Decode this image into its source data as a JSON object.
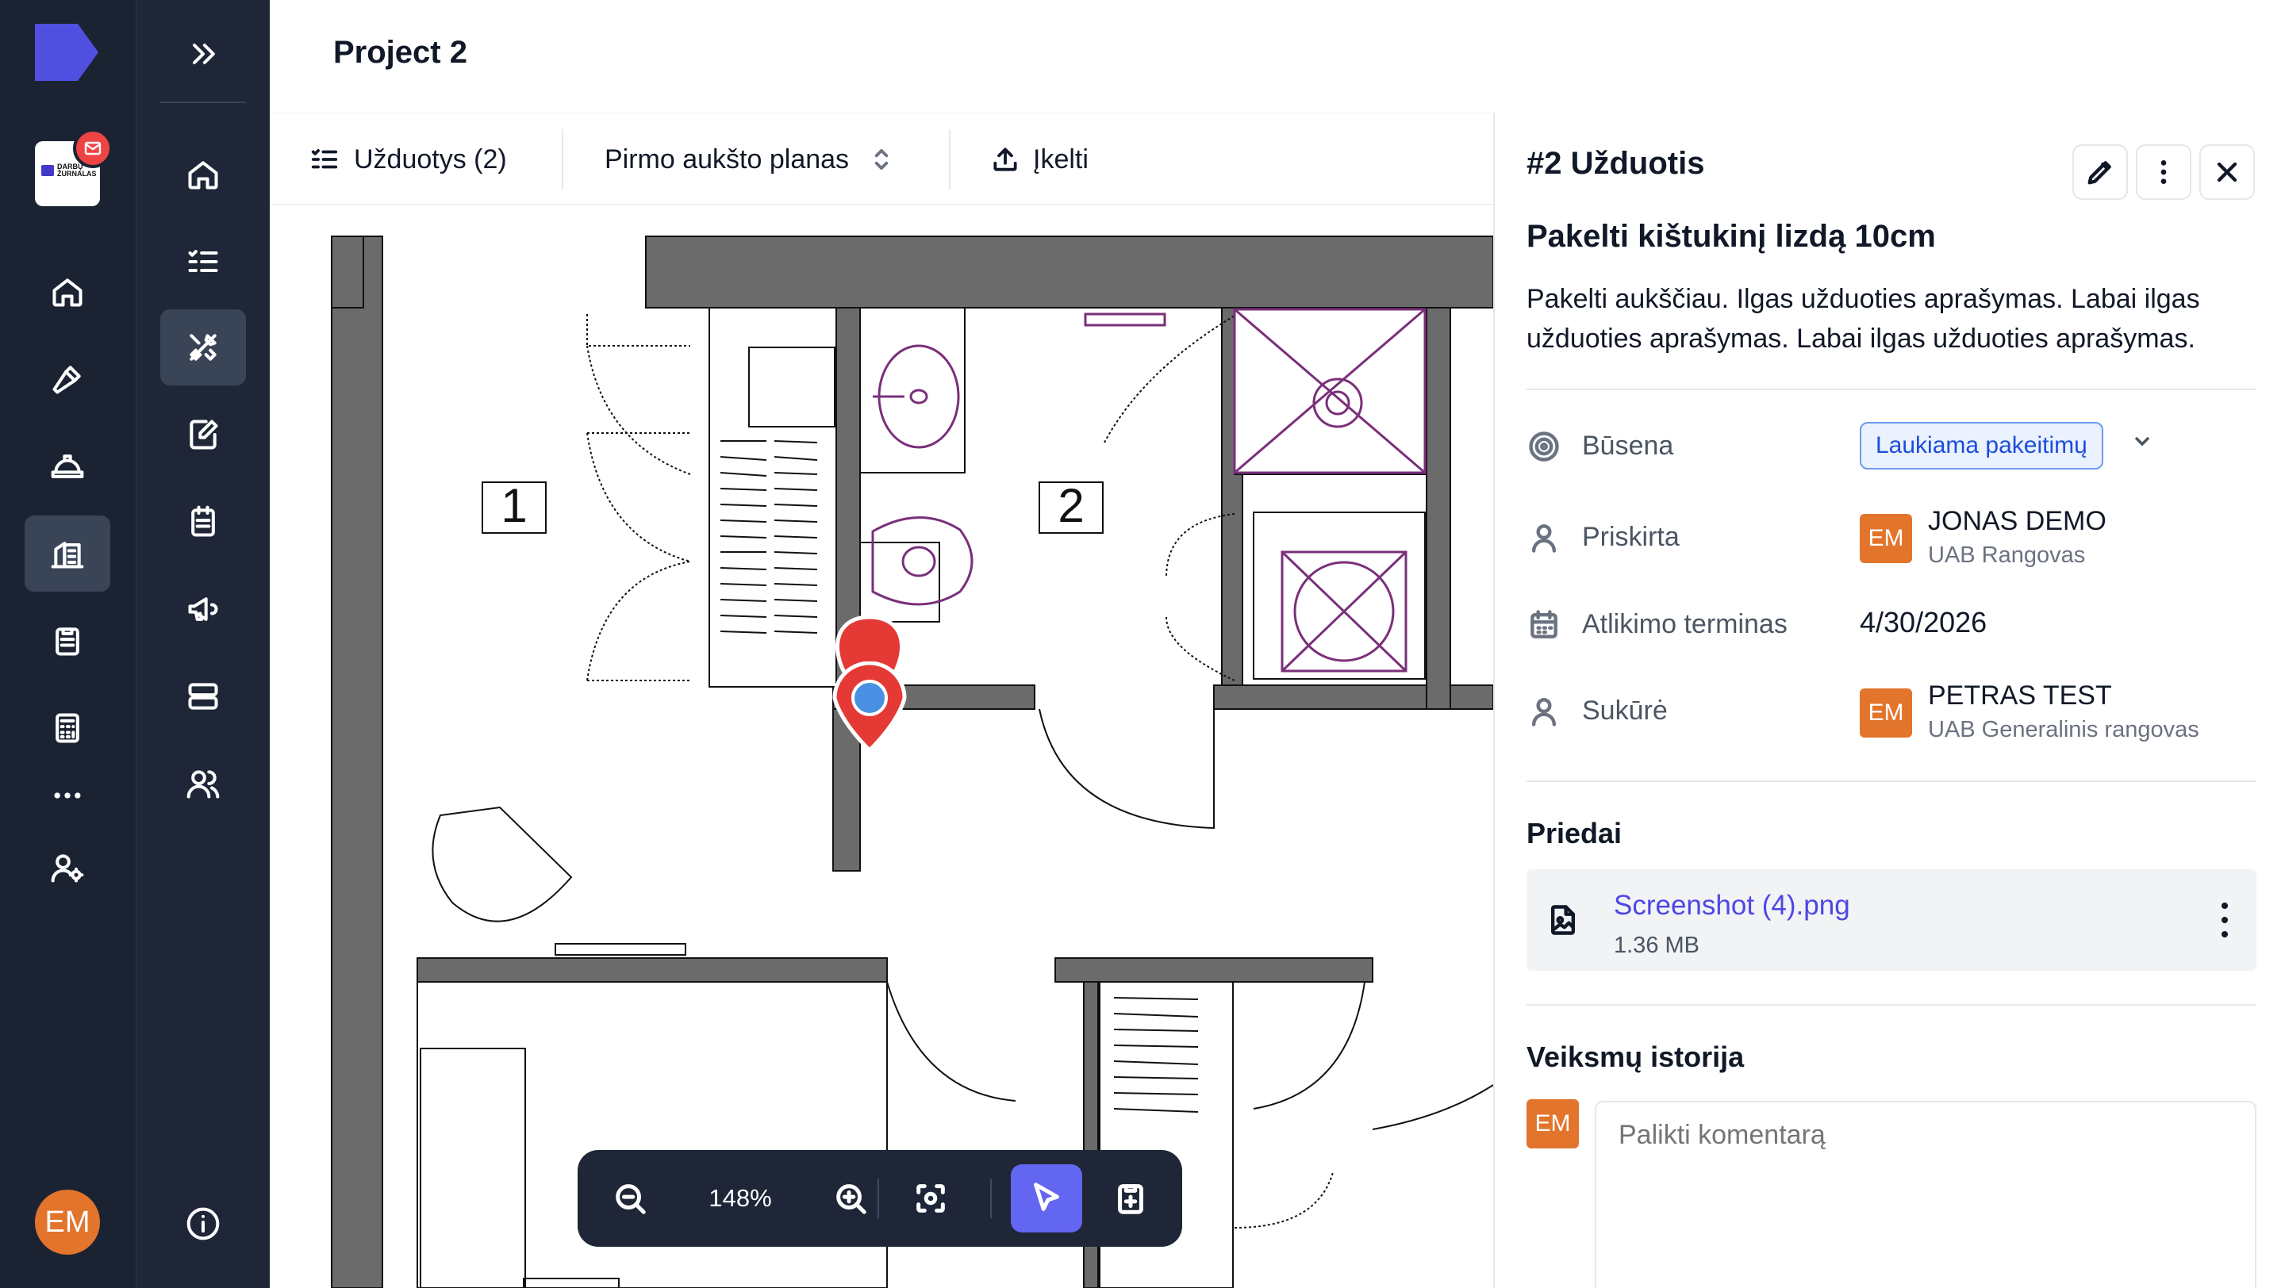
{
  "project": {
    "title": "Project 2"
  },
  "app_badge": {
    "text": "DARBŲ ŽURNALAS"
  },
  "user": {
    "initials": "EM"
  },
  "toolbar": {
    "tasks_label": "Užduotys (2)",
    "plan_label": "Pirmo aukšto planas",
    "upload_label": "Įkelti"
  },
  "plan": {
    "room_labels": [
      "1",
      "2"
    ]
  },
  "zoom": {
    "level": "148%"
  },
  "panel": {
    "title": "#2 Užduotis",
    "subtitle": "Pakelti kištukinį lizdą 10cm",
    "description": "Pakelti aukščiau. Ilgas užduoties aprašymas. Labai ilgas užduoties aprašymas. Labai ilgas užduoties aprašymas.",
    "status": {
      "label": "Būsena",
      "value": "Laukiama pakeitimų"
    },
    "assignee": {
      "label": "Priskirta",
      "initials": "EM",
      "name": "JONAS DEMO",
      "org": "UAB Rangovas"
    },
    "due": {
      "label": "Atlikimo terminas",
      "value": "4/30/2026"
    },
    "creator": {
      "label": "Sukūrė",
      "initials": "EM",
      "name": "PETRAS TEST",
      "org": "UAB Generalinis rangovas"
    },
    "attachments": {
      "title": "Priedai",
      "items": [
        {
          "name": "Screenshot (4).png",
          "size": "1.36 MB"
        }
      ]
    },
    "history": {
      "title": "Veiksmų istorija",
      "initials": "EM",
      "comment_placeholder": "Palikti komentarą"
    }
  },
  "colors": {
    "sidebar": "#1b2333",
    "accent": "#6366f1",
    "avatar": "#e2742c",
    "status_text": "#1d4ed8",
    "pin": "#e53935"
  }
}
